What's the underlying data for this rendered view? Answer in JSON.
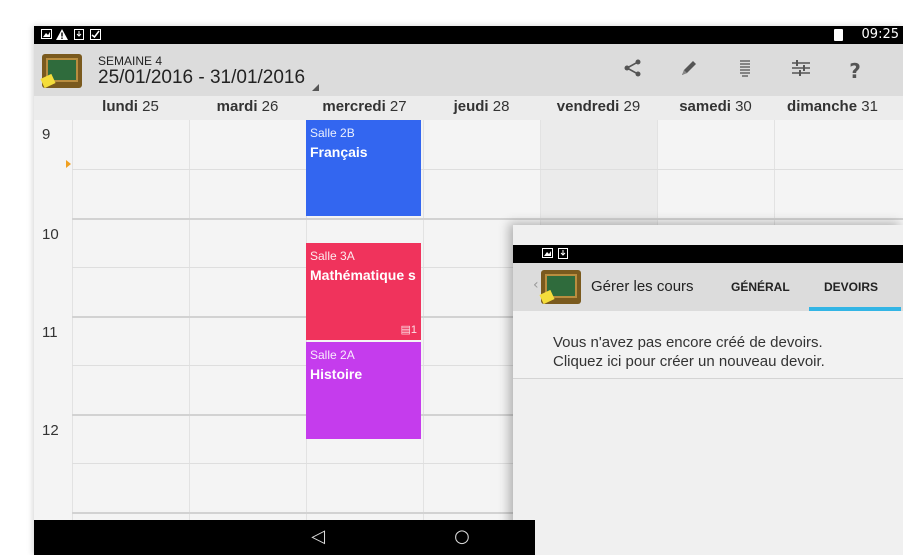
{
  "statusbar": {
    "time": "09:25",
    "icons": [
      "gallery-icon",
      "warning-icon",
      "download-icon",
      "check-icon"
    ]
  },
  "actionbar": {
    "week_label": "SEMAINE 4",
    "week_range": "25/01/2016 - 31/01/2016",
    "buttons": [
      "share-icon",
      "edit-icon",
      "list-icon",
      "settings-sliders-icon",
      "help-icon"
    ],
    "help_label": "?"
  },
  "days": [
    {
      "name": "lundi",
      "num": "25"
    },
    {
      "name": "mardi",
      "num": "26"
    },
    {
      "name": "mercredi",
      "num": "27"
    },
    {
      "name": "jeudi",
      "num": "28"
    },
    {
      "name": "vendredi",
      "num": "29"
    },
    {
      "name": "samedi",
      "num": "30"
    },
    {
      "name": "dimanche",
      "num": "31"
    }
  ],
  "hours": [
    "9",
    "10",
    "11",
    "12"
  ],
  "events": [
    {
      "room": "Salle 2B",
      "subject": "Français",
      "color": "#3366f0",
      "homework": ""
    },
    {
      "room": "Salle 3A",
      "subject": "Mathématique s",
      "color": "#f0335c",
      "homework": "1"
    },
    {
      "room": "Salle 2A",
      "subject": "Histoire",
      "color": "#c53ced",
      "homework": ""
    }
  ],
  "navbar": {
    "back": "◁",
    "home": "○"
  },
  "overlay": {
    "title": "Gérer les cours",
    "tabs": [
      {
        "label": "GÉNÉRAL",
        "selected": false
      },
      {
        "label": "DEVOIRS",
        "selected": true
      }
    ],
    "message_line1": "Vous n'avez pas encore créé de devoirs.",
    "message_line2": "Cliquez ici pour créer un nouveau devoir.",
    "accent_color": "#33b5e5"
  }
}
